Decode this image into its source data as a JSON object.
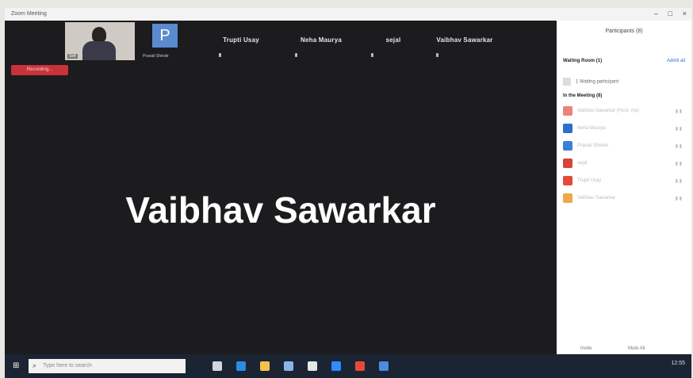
{
  "window": {
    "app_title": "Zoom Meeting",
    "minimize": "–",
    "maximize": "□",
    "close": "×"
  },
  "gallery": {
    "self_caption": "Self",
    "p_initial": "P",
    "p_caption": "Pranali Shinde",
    "tiles": [
      {
        "name": "Trupti Usay"
      },
      {
        "name": "Neha Maurya"
      },
      {
        "name": "sejal"
      },
      {
        "name": "Vaibhav Sawarkar"
      }
    ],
    "badge": "Recording..."
  },
  "stage": {
    "active_speaker": "Vaibhav Sawarkar"
  },
  "panel": {
    "title": "Participants (8)",
    "waiting_room_header": "Waiting Room (1)",
    "admit_all": "Admit all",
    "waiting_person": "1 Waiting participant",
    "in_meeting_header": "In the Meeting (8)",
    "participants": [
      {
        "name": "Vaibhav Sawarkar (Host, me)",
        "color": "#e8857a"
      },
      {
        "name": "Neha Maurya",
        "color": "#2b71c9"
      },
      {
        "name": "Pranali Shinde",
        "color": "#3b80d6"
      },
      {
        "name": "sejal",
        "color": "#d9433a"
      },
      {
        "name": "Trupti Usay",
        "color": "#e24a3a"
      },
      {
        "name": "Vaibhav Sawarkar",
        "color": "#f0a64a"
      }
    ],
    "invite": "Invite",
    "mute_all": "Mute All"
  },
  "taskbar": {
    "search_placeholder": "Type here to search",
    "icons": [
      {
        "name": "task-view-icon",
        "color": "#cfd6e0"
      },
      {
        "name": "edge-icon",
        "color": "#2b8de0"
      },
      {
        "name": "file-explorer-icon",
        "color": "#f2c14e"
      },
      {
        "name": "store-icon",
        "color": "#8ab4e8"
      },
      {
        "name": "vpn-icon",
        "color": "#e6e6e6"
      },
      {
        "name": "zoom-icon",
        "color": "#2d8cff"
      },
      {
        "name": "chrome-icon",
        "color": "#e84a3a"
      },
      {
        "name": "app-icon",
        "color": "#4c8ce0"
      }
    ],
    "time": "12:55"
  }
}
